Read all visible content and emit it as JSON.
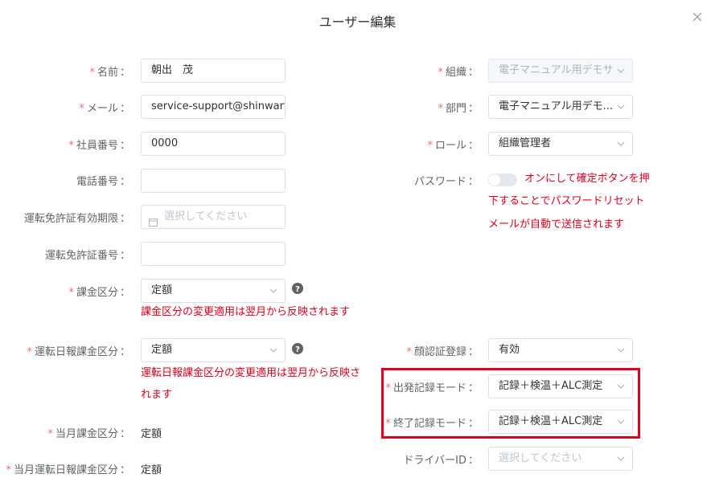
{
  "dialog": {
    "title": "ユーザー編集"
  },
  "fields": {
    "name": {
      "label": "名前",
      "value": "朝出　茂"
    },
    "email": {
      "label": "メール",
      "value": "service-support@shinwart.co"
    },
    "employee_no": {
      "label": "社員番号",
      "value": "0000"
    },
    "phone": {
      "label": "電話番号",
      "value": ""
    },
    "license_expiry": {
      "label": "運転免許証有効期限",
      "placeholder": "選択してください"
    },
    "license_no": {
      "label": "運転免許証番号",
      "value": ""
    },
    "billing": {
      "label": "課金区分",
      "value": "定額",
      "note": "課金区分の変更適用は翌月から反映されます"
    },
    "daily_billing": {
      "label": "運転日報課金区分",
      "value": "定額",
      "note_line1": "運転日報課金区分の変更適用は翌月から反映さ",
      "note_line2": "れます"
    },
    "current_billing": {
      "label": "当月課金区分",
      "value": "定額"
    },
    "current_daily_billing": {
      "label": "当月運転日報課金区分",
      "value": "定額"
    },
    "org": {
      "label": "組織",
      "value": "電子マニュアル用デモサイ"
    },
    "dept": {
      "label": "部門",
      "value": "電子マニュアル用デモ..."
    },
    "role": {
      "label": "ロール",
      "value": "組織管理者"
    },
    "password": {
      "label": "パスワード",
      "note_line1": "オンにして確定ボタンを押",
      "note_line2": "下することでパスワードリセット",
      "note_line3": "メールが自動で送信されます"
    },
    "face": {
      "label": "顔認証登録",
      "value": "有効"
    },
    "start_mode": {
      "label": "出発記録モード",
      "value": "記録＋検温＋ALC測定"
    },
    "end_mode": {
      "label": "終了記録モード",
      "value": "記録＋検温＋ALC測定"
    },
    "driver_id": {
      "label": "ドライバーID",
      "placeholder": "選択してください"
    }
  },
  "common": {
    "star": "*",
    "colon": "："
  },
  "colors": {
    "required": "#f56c6c",
    "warning": "#d9001b",
    "highlight_box": "#e0001e"
  }
}
